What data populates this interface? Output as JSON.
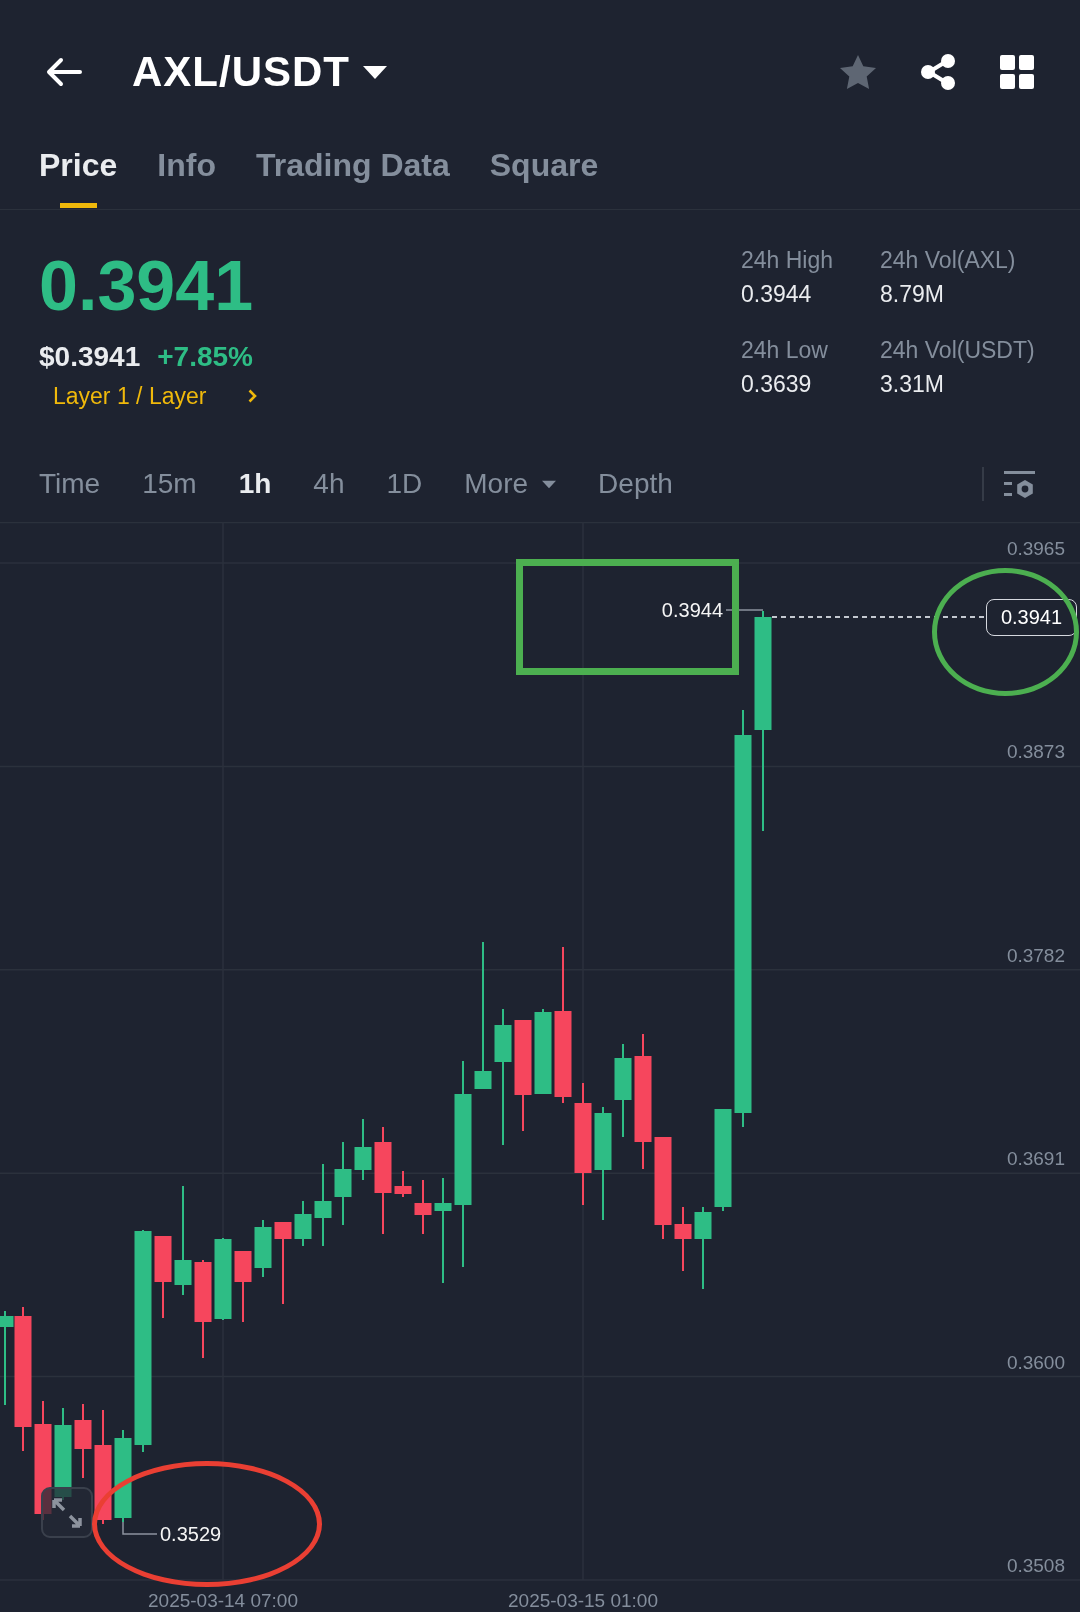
{
  "header": {
    "pair": "AXL/USDT",
    "favorite": false
  },
  "tabs": [
    {
      "label": "Price",
      "selected": true
    },
    {
      "label": "Info",
      "selected": false
    },
    {
      "label": "Trading Data",
      "selected": false
    },
    {
      "label": "Square",
      "selected": false
    }
  ],
  "price": {
    "last": "0.3941",
    "usd": "$0.3941",
    "change": "+7.85%",
    "category": "Layer 1 / Layer"
  },
  "stats": [
    {
      "label": "24h High",
      "value": "0.3944"
    },
    {
      "label": "24h Vol(AXL)",
      "value": "8.79M"
    },
    {
      "label": "24h Low",
      "value": "0.3639"
    },
    {
      "label": "24h Vol(USDT)",
      "value": "3.31M"
    }
  ],
  "intervals": [
    {
      "label": "Time",
      "kind": "option",
      "selected": false
    },
    {
      "label": "15m",
      "kind": "option",
      "selected": false
    },
    {
      "label": "1h",
      "kind": "option",
      "selected": true
    },
    {
      "label": "4h",
      "kind": "option",
      "selected": false
    },
    {
      "label": "1D",
      "kind": "option",
      "selected": false
    },
    {
      "label": "More",
      "kind": "dropdown",
      "selected": false
    },
    {
      "label": "Depth",
      "kind": "option",
      "selected": false
    }
  ],
  "chart": {
    "price_labels": [
      "0.3965",
      "0.3873",
      "0.3782",
      "0.3691",
      "0.3600",
      "0.3508"
    ],
    "time_labels": [
      "2025-03-14 07:00",
      "2025-03-15 01:00"
    ],
    "high_marker": "0.3944",
    "low_marker": "0.3529",
    "last_price": "0.3941"
  }
}
